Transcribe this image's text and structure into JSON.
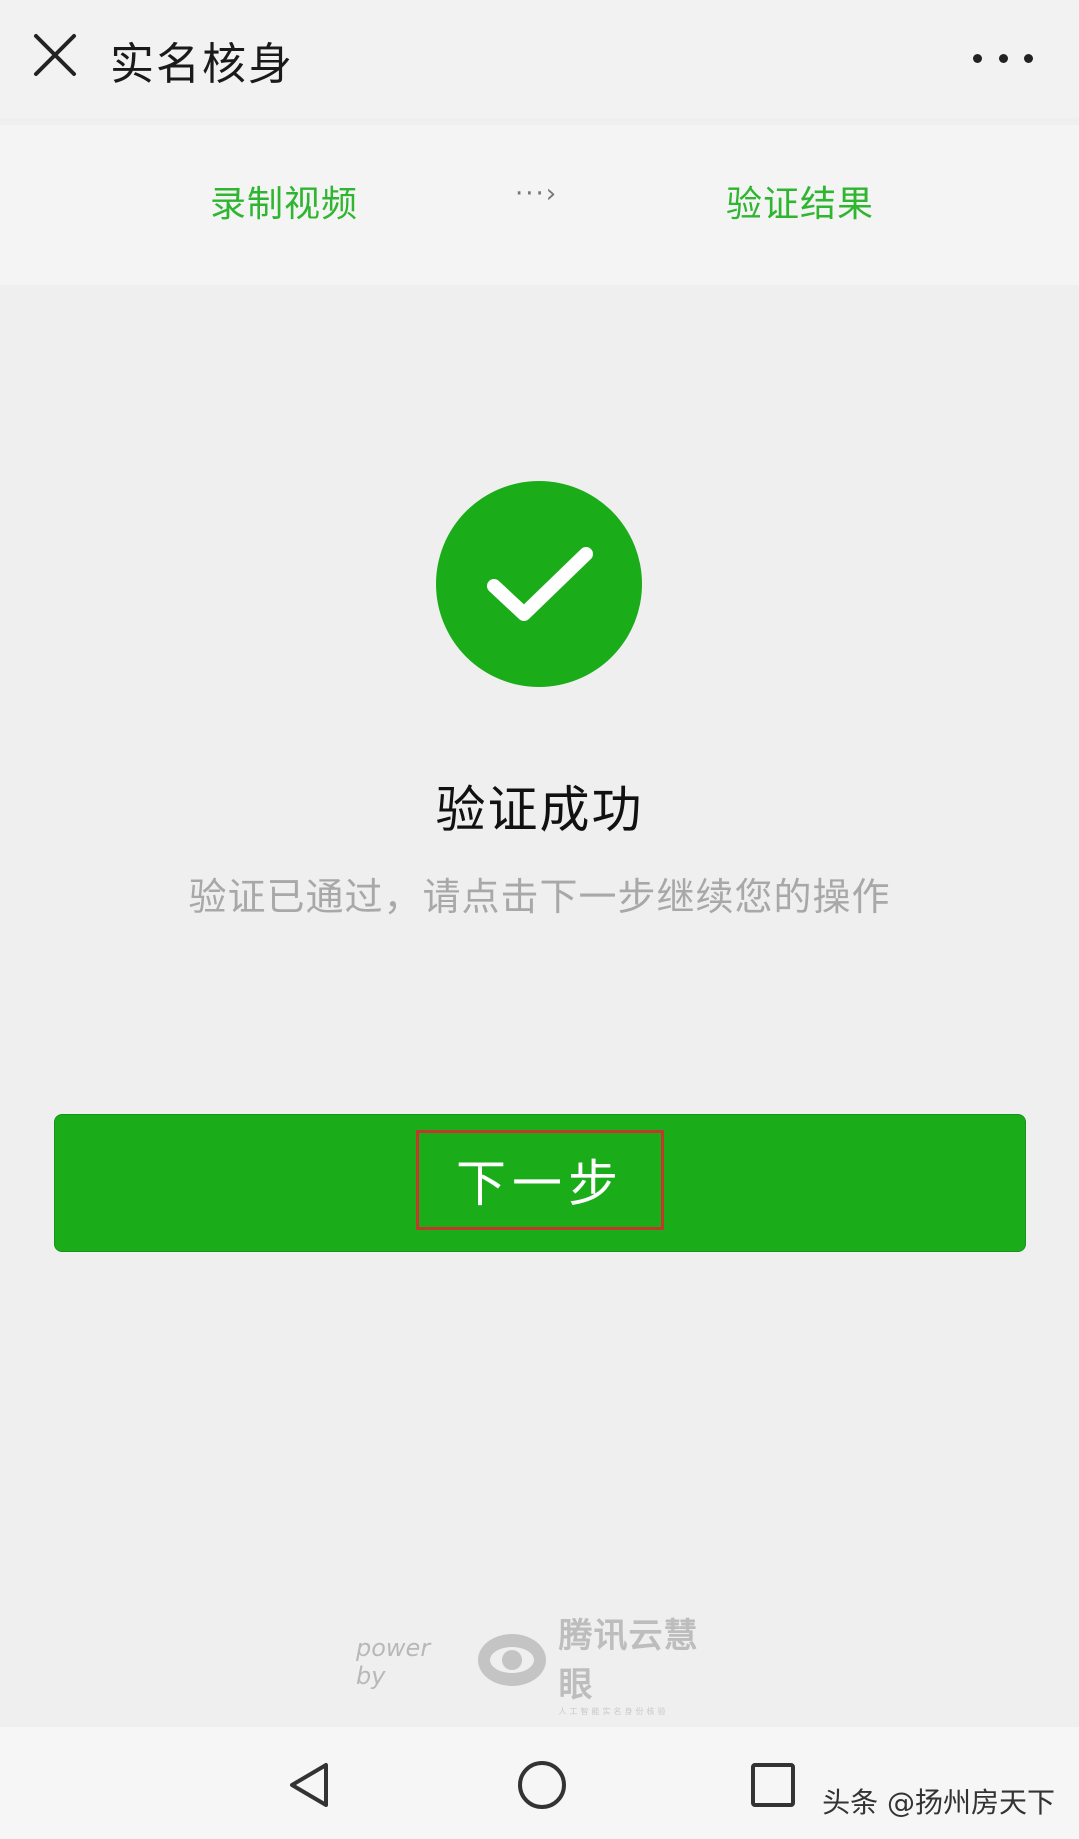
{
  "header": {
    "title": "实名核身",
    "close_icon": "close-icon",
    "more_icon": "more-horizontal-icon"
  },
  "steps": {
    "step1": "录制视频",
    "arrow": "···›",
    "step2": "验证结果"
  },
  "result": {
    "icon": "check-circle-icon",
    "title": "验证成功",
    "message": "验证已通过，请点击下一步继续您的操作"
  },
  "actions": {
    "next_label": "下一步"
  },
  "footer": {
    "powered_by": "power by",
    "brand": "腾讯云慧眼",
    "tagline": "人工智能实名身份核验"
  },
  "system_nav": {
    "back_icon": "back-triangle-icon",
    "home_icon": "home-circle-icon",
    "recent_icon": "recent-square-icon"
  },
  "watermark": "头条 @扬州房天下",
  "colors": {
    "accent_green": "#1aad19",
    "step_green": "#2fb52f",
    "highlight_red": "#c0392b",
    "background": "#efefef"
  }
}
